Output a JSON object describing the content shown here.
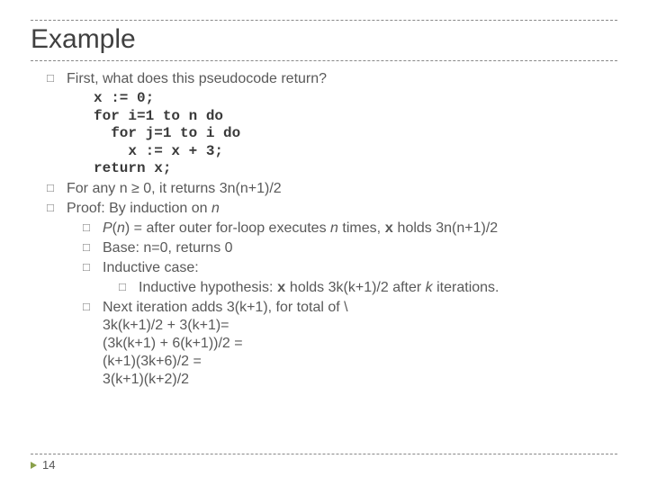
{
  "title": "Example",
  "bullets": {
    "b1": "First, what does this pseudocode return?",
    "code": "x := 0;\nfor i=1 to n do\n  for j=1 to i do\n    x := x + 3;\nreturn x;",
    "b2_pre": "For any n ≥ 0, it returns 3n(n+1)/2",
    "b3_pre": "Proof: By induction on ",
    "b3_ital": "n",
    "sub": {
      "s1_pre": "",
      "s1_ital": "P",
      "s1_mid": "(",
      "s1_ital2": "n",
      "s1_post": ") = after outer for-loop executes ",
      "s1_ital3": "n",
      "s1_post2": " times, ",
      "s1_mono": "x",
      "s1_end": " holds 3n(n+1)/2",
      "s2": "Base: n=0, returns 0",
      "s3": "Inductive case:",
      "s3a_pre": "Inductive hypothesis: ",
      "s3a_mono": "x",
      "s3a_mid": " holds 3k(k+1)/2 after ",
      "s3a_ital": "k",
      "s3a_end": " iterations.",
      "s4_l1": "Next iteration adds 3(k+1), for total of \\",
      "s4_l2": "3k(k+1)/2 + 3(k+1)=",
      "s4_l3": "(3k(k+1) + 6(k+1))/2 =",
      "s4_l4": "(k+1)(3k+6)/2 =",
      "s4_l5": "3(k+1)(k+2)/2"
    }
  },
  "page_number": "14"
}
